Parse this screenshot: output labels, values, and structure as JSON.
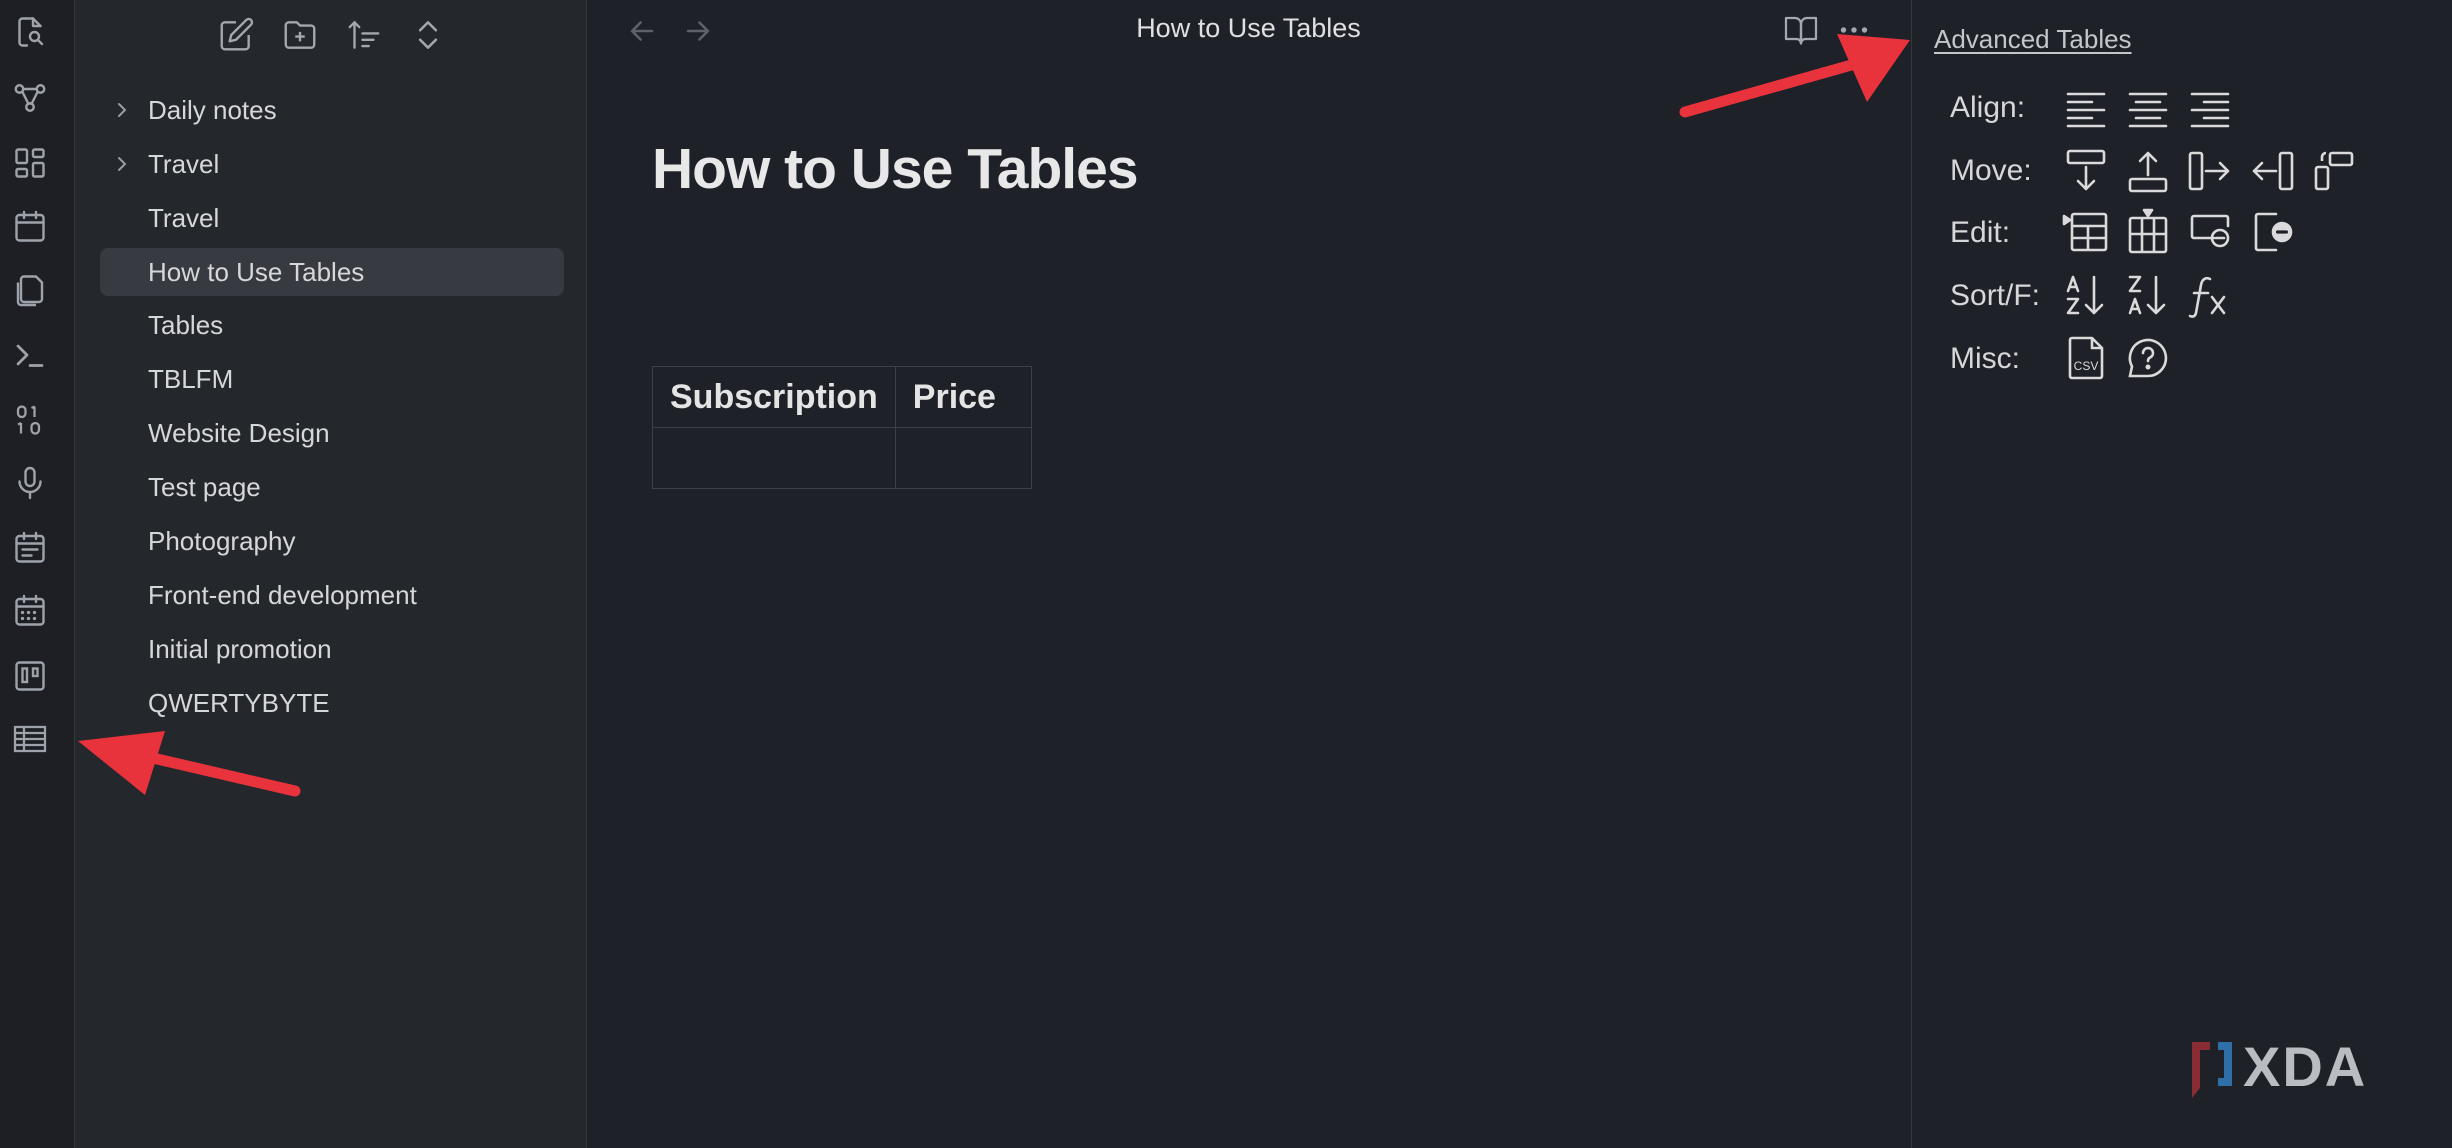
{
  "ribbon": {
    "icons": [
      "quick-switcher-icon",
      "graph-view-icon",
      "canvas-icon",
      "daily-note-icon",
      "templates-icon",
      "command-palette-icon",
      "random-note-icon",
      "audio-recorder-icon",
      "calendar-icon",
      "calendar-grid-icon",
      "kanban-icon",
      "advanced-tables-icon"
    ]
  },
  "sidebar": {
    "tools": [
      "new-note-icon",
      "new-folder-icon",
      "sort-icon",
      "collapse-icon"
    ],
    "files": [
      {
        "label": "Daily notes",
        "folder": true,
        "active": false
      },
      {
        "label": "Travel",
        "folder": true,
        "active": false
      },
      {
        "label": "Travel",
        "folder": false,
        "active": false
      },
      {
        "label": "How to Use Tables",
        "folder": false,
        "active": true
      },
      {
        "label": "Tables",
        "folder": false,
        "active": false
      },
      {
        "label": "TBLFM",
        "folder": false,
        "active": false
      },
      {
        "label": "Website Design",
        "folder": false,
        "active": false
      },
      {
        "label": "Test page",
        "folder": false,
        "active": false
      },
      {
        "label": "Photography",
        "folder": false,
        "active": false
      },
      {
        "label": "Front-end development",
        "folder": false,
        "active": false
      },
      {
        "label": "Initial promotion",
        "folder": false,
        "active": false
      },
      {
        "label": "QWERTYBYTE",
        "folder": false,
        "active": false
      }
    ]
  },
  "editor": {
    "tab_title": "How to Use Tables",
    "doc_title": "How to Use Tables",
    "table": {
      "headers": [
        "Subscription",
        "Price"
      ],
      "rows": [
        [
          "",
          ""
        ]
      ]
    }
  },
  "advanced_tables": {
    "title": "Advanced Tables",
    "rows": [
      {
        "label": "Align:",
        "tools": [
          "align-left-icon",
          "align-center-icon",
          "align-right-icon"
        ]
      },
      {
        "label": "Move:",
        "tools": [
          "move-row-down-icon",
          "move-row-up-icon",
          "move-column-right-icon",
          "move-column-left-icon",
          "transpose-icon"
        ]
      },
      {
        "label": "Edit:",
        "tools": [
          "insert-row-icon",
          "insert-column-icon",
          "delete-row-icon",
          "delete-column-icon"
        ]
      },
      {
        "label": "Sort/F:",
        "tools": [
          "sort-ascending-icon",
          "sort-descending-icon",
          "formula-icon"
        ]
      },
      {
        "label": "Misc:",
        "tools": [
          "export-csv-icon",
          "help-icon"
        ]
      }
    ]
  },
  "colors": {
    "background": "#1e2127",
    "sidebar": "#24272c",
    "active_item": "#373a40",
    "annotation_arrow": "#e8323c"
  },
  "watermark": "XDA"
}
